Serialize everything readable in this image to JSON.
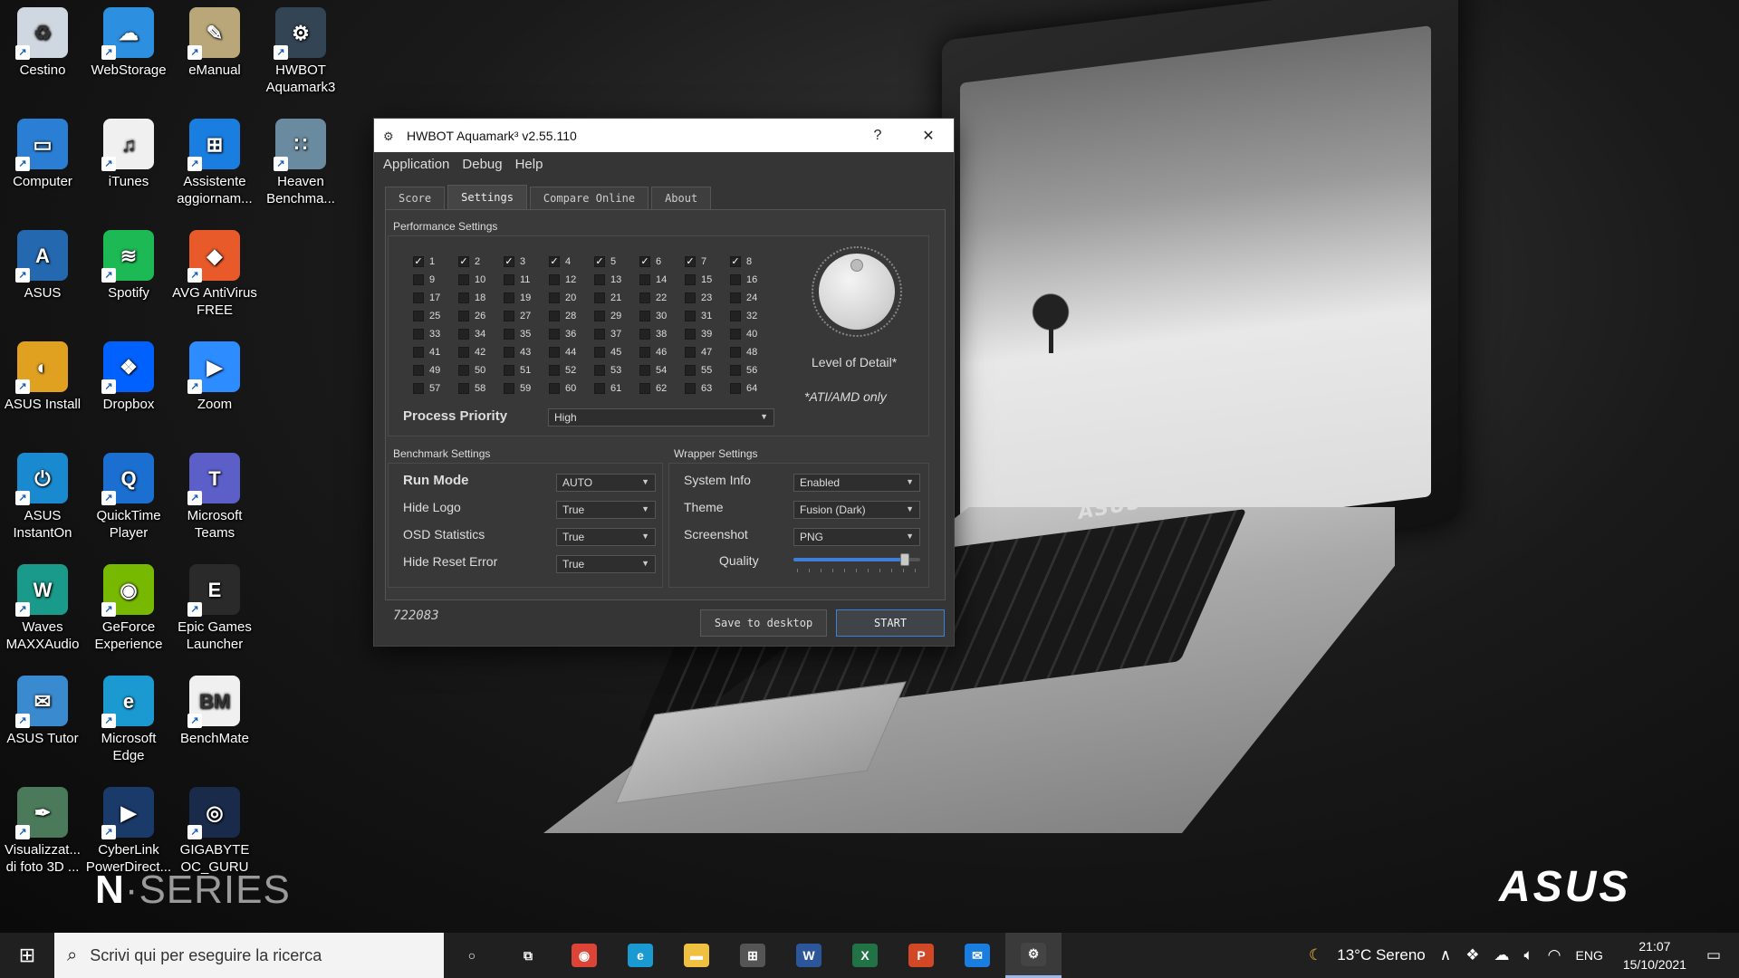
{
  "desktop": {
    "icons": [
      {
        "label": "Cestino",
        "color": "#cfd8e0",
        "glyph": "♻"
      },
      {
        "label": "WebStorage",
        "color": "#2d8fe0",
        "glyph": "☁"
      },
      {
        "label": "eManual",
        "color": "#b9a77a",
        "glyph": "✎"
      },
      {
        "label": "HWBOT Aquamark3",
        "color": "#334455",
        "glyph": "⚙"
      },
      {
        "label": "Computer",
        "color": "#2a7fd4",
        "glyph": "▭"
      },
      {
        "label": "iTunes",
        "color": "#f0f0f0",
        "glyph": "♫"
      },
      {
        "label": "Assistente aggiornam...",
        "color": "#1a7ee0",
        "glyph": "⊞"
      },
      {
        "label": "Heaven Benchma...",
        "color": "#6a8aa0",
        "glyph": "∷"
      },
      {
        "label": "ASUS",
        "color": "#2468b0",
        "glyph": "A"
      },
      {
        "label": "Spotify",
        "color": "#1db954",
        "glyph": "≋"
      },
      {
        "label": "AVG AntiVirus FREE",
        "color": "#e85a2a",
        "glyph": "◆"
      },
      {
        "label": "ASUS Install",
        "color": "#e0a020",
        "glyph": "◐"
      },
      {
        "label": "Dropbox",
        "color": "#0061fe",
        "glyph": "❖"
      },
      {
        "label": "Zoom",
        "color": "#2d8cff",
        "glyph": "▶"
      },
      {
        "label": "ASUS InstantOn",
        "color": "#1a8ad0",
        "glyph": "⏻"
      },
      {
        "label": "QuickTime Player",
        "color": "#1a6fd0",
        "glyph": "Q"
      },
      {
        "label": "Microsoft Teams",
        "color": "#5b5fc7",
        "glyph": "T"
      },
      {
        "label": "Waves MAXXAudio",
        "color": "#1a9a8a",
        "glyph": "W"
      },
      {
        "label": "GeForce Experience",
        "color": "#76b900",
        "glyph": "◉"
      },
      {
        "label": "Epic Games Launcher",
        "color": "#2a2a2a",
        "glyph": "E"
      },
      {
        "label": "ASUS Tutor",
        "color": "#3a8ad0",
        "glyph": "✉"
      },
      {
        "label": "Microsoft Edge",
        "color": "#1a9ad0",
        "glyph": "e"
      },
      {
        "label": "BenchMate",
        "color": "#f0f0f0",
        "glyph": "BM"
      },
      {
        "label": "Visualizzat... di foto 3D ...",
        "color": "#4a7a5a",
        "glyph": "✒"
      },
      {
        "label": "CyberLink PowerDirect...",
        "color": "#1a3a6a",
        "glyph": "▶"
      },
      {
        "label": "GIGABYTE OC_GURU",
        "color": "#1a2a4a",
        "glyph": "◎"
      }
    ],
    "brand": {
      "series_n": "N",
      "series_dot": "·",
      "series_word": "SERIES",
      "asus": "ASUS",
      "lid_logo": "ASUS"
    }
  },
  "window": {
    "title": "HWBOT Aquamark³ v2.55.110",
    "help_btn": "?",
    "close_btn": "✕",
    "menu": [
      "Application",
      "Debug",
      "Help"
    ],
    "tabs": [
      "Score",
      "Settings",
      "Compare Online",
      "About"
    ],
    "active_tab": "Settings",
    "performance": {
      "title": "Performance Settings",
      "checked_count": 8,
      "checks": [
        "1",
        "2",
        "3",
        "4",
        "5",
        "6",
        "7",
        "8",
        "9",
        "10",
        "11",
        "12",
        "13",
        "14",
        "15",
        "16",
        "17",
        "18",
        "19",
        "20",
        "21",
        "22",
        "23",
        "24",
        "25",
        "26",
        "27",
        "28",
        "29",
        "30",
        "31",
        "32",
        "33",
        "34",
        "35",
        "36",
        "37",
        "38",
        "39",
        "40",
        "41",
        "42",
        "43",
        "44",
        "45",
        "46",
        "47",
        "48",
        "49",
        "50",
        "51",
        "52",
        "53",
        "54",
        "55",
        "56",
        "57",
        "58",
        "59",
        "60",
        "61",
        "62",
        "63",
        "64"
      ],
      "lod_label": "Level of Detail*",
      "ati_note": "*ATI/AMD only",
      "priority_label": "Process Priority",
      "priority_value": "High"
    },
    "benchmark": {
      "title": "Benchmark Settings",
      "rows": [
        {
          "label": "Run Mode",
          "value": "AUTO"
        },
        {
          "label": "Hide Logo",
          "value": "True"
        },
        {
          "label": "OSD Statistics",
          "value": "True"
        },
        {
          "label": "Hide Reset Error",
          "value": "True"
        }
      ]
    },
    "wrapper": {
      "title": "Wrapper Settings",
      "rows": [
        {
          "label": "System Info",
          "value": "Enabled"
        },
        {
          "label": "Theme",
          "value": "Fusion (Dark)"
        },
        {
          "label": "Screenshot",
          "value": "PNG"
        }
      ],
      "quality_label": "Quality",
      "quality_fraction": 0.88
    },
    "score_value": "722083",
    "save_btn": "Save to desktop",
    "start_btn": "START",
    "accent": "#3d7fd9"
  },
  "taskbar": {
    "start_glyph": "⊞",
    "search_placeholder": "Scrivi qui per eseguire la ricerca",
    "apps": [
      {
        "name": "cortana",
        "glyph": "○",
        "color": "transparent"
      },
      {
        "name": "task-view",
        "glyph": "⧉",
        "color": "transparent"
      },
      {
        "name": "chrome",
        "glyph": "◉",
        "color": "#db4437"
      },
      {
        "name": "edge",
        "glyph": "e",
        "color": "#1a9ad0"
      },
      {
        "name": "explorer",
        "glyph": "▬",
        "color": "#f0c040"
      },
      {
        "name": "store",
        "glyph": "⊞",
        "color": "#555"
      },
      {
        "name": "word",
        "glyph": "W",
        "color": "#2b579a"
      },
      {
        "name": "excel",
        "glyph": "X",
        "color": "#217346"
      },
      {
        "name": "powerpoint",
        "glyph": "P",
        "color": "#d24726"
      },
      {
        "name": "mail",
        "glyph": "✉",
        "color": "#1a7ee0"
      },
      {
        "name": "aquamark",
        "glyph": "⚙",
        "color": "#444"
      }
    ],
    "weather": "13°C  Sereno",
    "language": "ENG",
    "time": "21:07",
    "date": "15/10/2021"
  }
}
